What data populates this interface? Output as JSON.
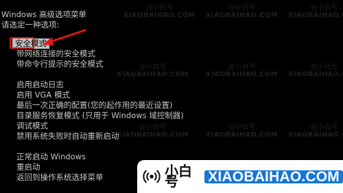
{
  "header": {
    "title": "Windows 高级选项菜单",
    "prompt": "请选定一种选项:"
  },
  "menu": {
    "group1": [
      {
        "label": "安全模式",
        "selected": true
      },
      {
        "label": "带网络连接的安全模式"
      },
      {
        "label": "带命令行提示的安全模式"
      }
    ],
    "group2": [
      {
        "label": "启用启动日志"
      },
      {
        "label": "启用 VGA 模式"
      },
      {
        "label": "最后一次正确的配置(您的起作用的最近设置)"
      },
      {
        "label": "目录服务恢复模式 (只用于 Windows 域控制器)"
      },
      {
        "label": "调试模式"
      },
      {
        "label": "禁用系统失败时自动重新启动"
      }
    ],
    "group3": [
      {
        "label": "正常启动 Windows"
      },
      {
        "label": "重启动"
      },
      {
        "label": "返回到操作系统选择菜单"
      }
    ]
  },
  "watermark": {
    "line1": "@小白号",
    "line2": "XIAOBAIHAO.COM"
  },
  "brand": {
    "name_cn": "小白号",
    "name_en": "XIAOBAIHAO.COM",
    "icon": "broadcast-icon"
  },
  "colors": {
    "background": "#000000",
    "text": "#c4c4c4",
    "selection": "#c0c0c0",
    "highlight": "#e0151a",
    "brand_blue": "#1677d6"
  }
}
